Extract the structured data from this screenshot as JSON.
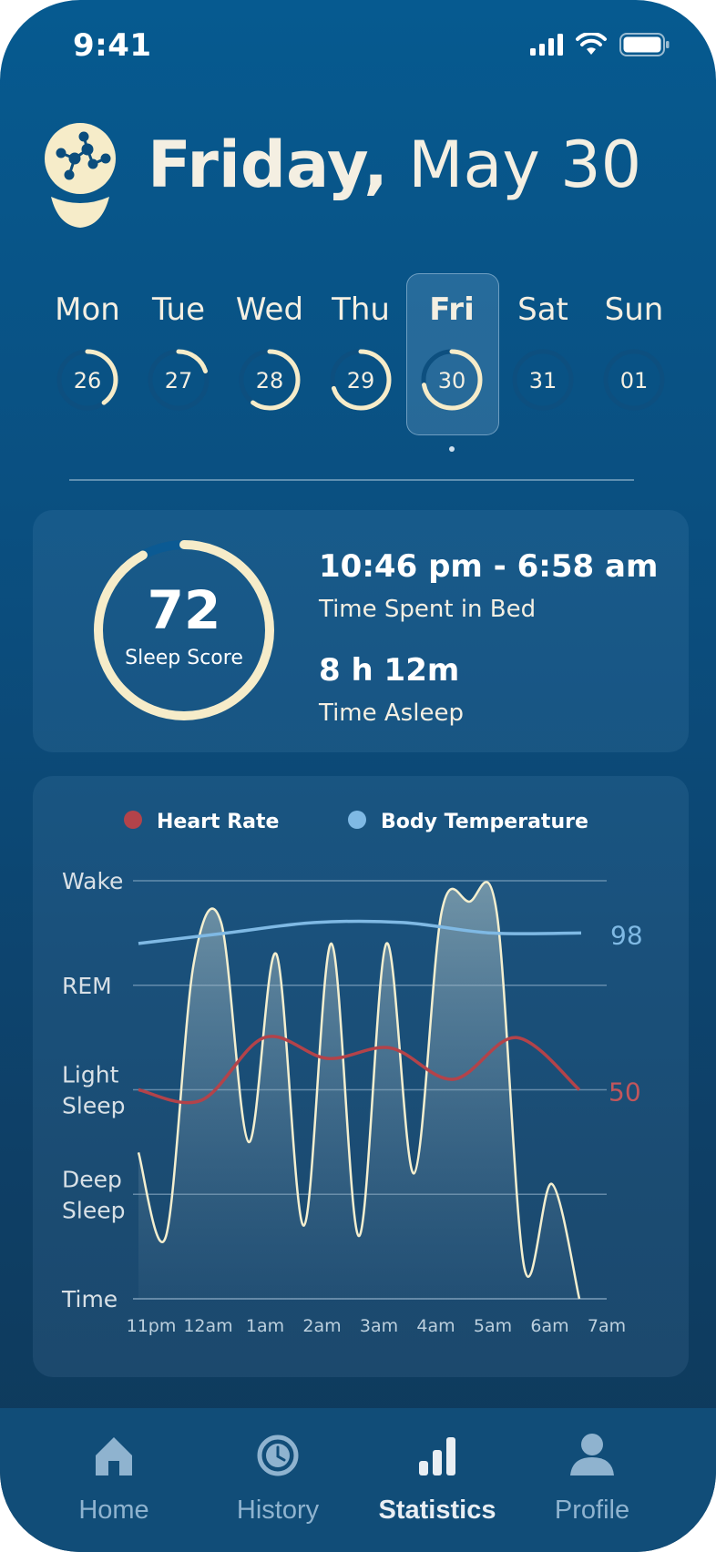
{
  "status_bar": {
    "time": "9:41"
  },
  "header": {
    "weekday": "Friday,",
    "date": "May 30"
  },
  "week": [
    {
      "name": "Mon",
      "num": "26",
      "progress": 0.4,
      "selected": false
    },
    {
      "name": "Tue",
      "num": "27",
      "progress": 0.2,
      "selected": false
    },
    {
      "name": "Wed",
      "num": "28",
      "progress": 0.6,
      "selected": false
    },
    {
      "name": "Thu",
      "num": "29",
      "progress": 0.7,
      "selected": false
    },
    {
      "name": "Fri",
      "num": "30",
      "progress": 0.72,
      "selected": true
    },
    {
      "name": "Sat",
      "num": "31",
      "progress": 0,
      "selected": false
    },
    {
      "name": "Sun",
      "num": "01",
      "progress": 0,
      "selected": false
    }
  ],
  "summary": {
    "score": "72",
    "score_label": "Sleep Score",
    "score_fraction": 0.92,
    "bed_time": "10:46 pm - 6:58 am",
    "bed_label": "Time Spent in Bed",
    "asleep_value": "8 h 12m",
    "asleep_label": "Time Asleep"
  },
  "chart_data": {
    "type": "line",
    "legend": [
      {
        "name": "Heart Rate",
        "color": "#b3434a"
      },
      {
        "name": "Body Temperature",
        "color": "#7fb9e4"
      }
    ],
    "y_stage_labels": [
      "Wake",
      "REM",
      "Light Sleep",
      "Deep Sleep",
      "Time"
    ],
    "x_labels": [
      "11pm",
      "12am",
      "1am",
      "2am",
      "3am",
      "4am",
      "5am",
      "6am",
      "7am"
    ],
    "series": [
      {
        "name": "Sleep stage",
        "color": "#f4efcf",
        "values": [
          1.4,
          0.6,
          3.2,
          3.6,
          1.5,
          3.3,
          0.7,
          3.4,
          0.6,
          3.4,
          1.2,
          3.7,
          3.8,
          3.7,
          0.3,
          1.1,
          0.0
        ]
      },
      {
        "name": "Heart Rate",
        "color": "#b3434a",
        "values": [
          2.0,
          1.9,
          2.5,
          2.3,
          2.4,
          2.1,
          2.5,
          2.0
        ]
      },
      {
        "name": "Body Temperature",
        "color": "#7fb9e4",
        "values": [
          3.4,
          3.5,
          3.6,
          3.6,
          3.5,
          3.5
        ]
      }
    ],
    "end_labels": {
      "Body Temperature": "98",
      "Heart Rate": "50"
    },
    "colors": {
      "heart_rate": "#b3434a",
      "body_temperature": "#7fb9e4",
      "sleep": "#f4efcf"
    }
  },
  "tabs": [
    {
      "label": "Home",
      "icon": "home-icon",
      "active": false
    },
    {
      "label": "History",
      "icon": "history-icon",
      "active": false
    },
    {
      "label": "Statistics",
      "icon": "statistics-icon",
      "active": true
    },
    {
      "label": "Profile",
      "icon": "profile-icon",
      "active": false
    }
  ]
}
